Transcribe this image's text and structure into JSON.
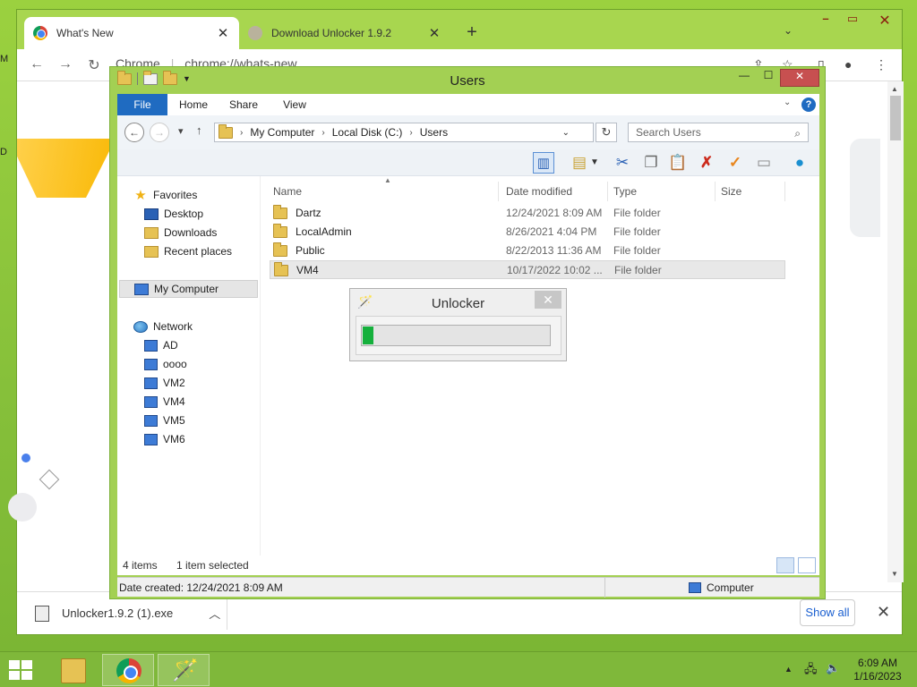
{
  "colors": {
    "desktop_bg": "#8bc43a",
    "explorer_accent": "#1f6bc1",
    "progress_fill": "#15b03c"
  },
  "desktop": {
    "edge_labels": [
      "M",
      "D"
    ]
  },
  "chrome": {
    "tabs": [
      {
        "label": "What's New",
        "icon": "chrome-icon"
      },
      {
        "label": "Download Unlocker 1.9.2",
        "icon": "gear-icon"
      }
    ],
    "address": "chrome://whats-new",
    "address_prefix": "Chrome",
    "download": {
      "filename": "Unlocker1.9.2 (1).exe",
      "show_all": "Show all"
    }
  },
  "explorer": {
    "title": "Users",
    "ribbon_tabs": [
      "File",
      "Home",
      "Share",
      "View"
    ],
    "help": "?",
    "breadcrumb": [
      "My Computer",
      "Local Disk (C:)",
      "Users"
    ],
    "search_placeholder": "Search Users",
    "nav": {
      "favorites_label": "Favorites",
      "favorites": [
        "Desktop",
        "Downloads",
        "Recent places"
      ],
      "computer_label": "My Computer",
      "network_label": "Network",
      "network_hosts": [
        "AD",
        "oooo",
        "VM2",
        "VM4",
        "VM5",
        "VM6"
      ]
    },
    "columns": [
      "Name",
      "Date modified",
      "Type",
      "Size"
    ],
    "files": [
      {
        "name": "Dartz",
        "date": "12/24/2021 8:09 AM",
        "type": "File folder"
      },
      {
        "name": "LocalAdmin",
        "date": "8/26/2021 4:04 PM",
        "type": "File folder"
      },
      {
        "name": "Public",
        "date": "8/22/2013 11:36 AM",
        "type": "File folder"
      },
      {
        "name": "VM4",
        "date": "10/17/2022 10:02 ...",
        "type": "File folder"
      }
    ],
    "status": {
      "item_count": "4 items",
      "selected": "1 item selected"
    },
    "details": {
      "date_created": "Date created: 12/24/2021 8:09 AM",
      "location": "Computer"
    }
  },
  "unlocker": {
    "title": "Unlocker",
    "close": "✕",
    "progress_fraction": 0.06
  },
  "taskbar": {
    "time": "6:09 AM",
    "date": "1/16/2023"
  }
}
